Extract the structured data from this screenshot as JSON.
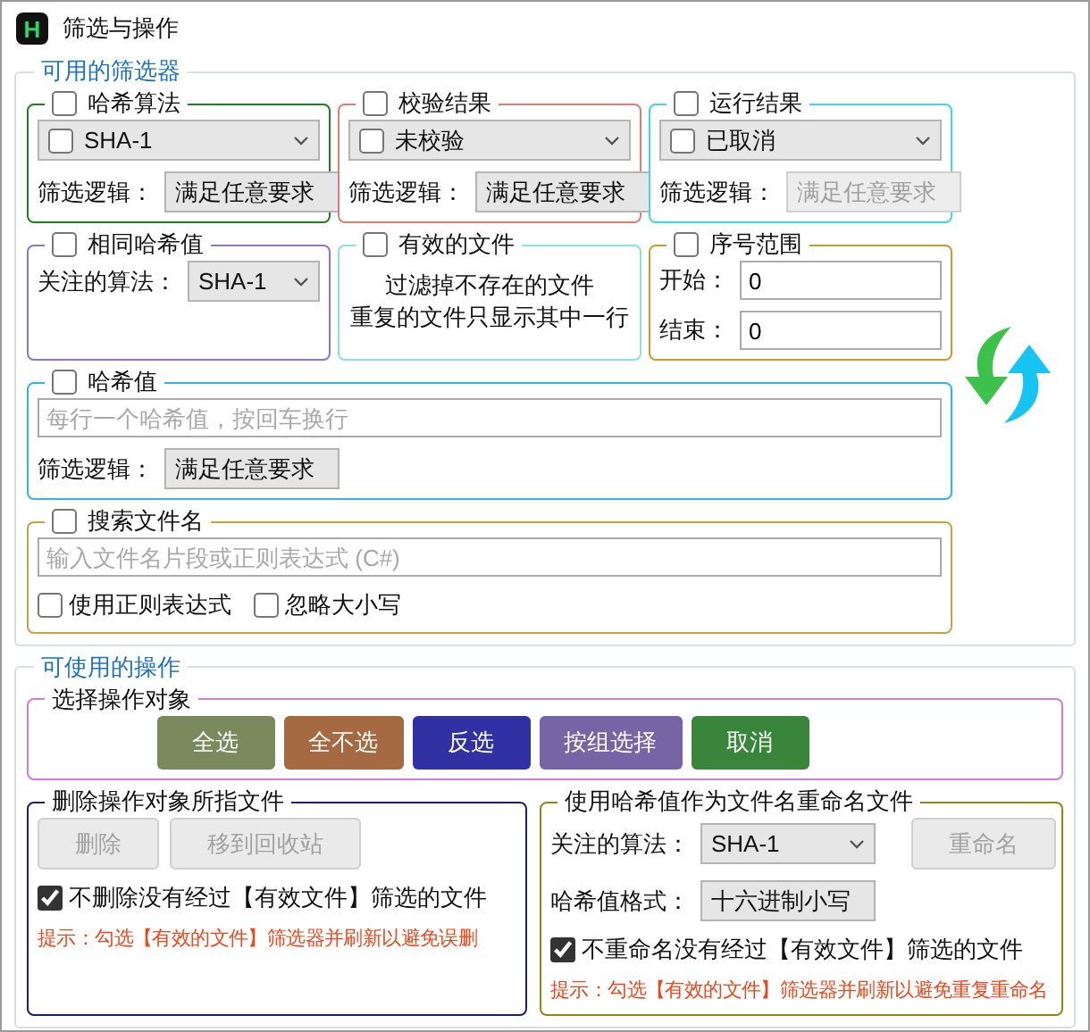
{
  "window": {
    "title": "筛选与操作",
    "app_icon_letter": "H"
  },
  "filters": {
    "title": "可用的筛选器",
    "groups": [
      {
        "label": "哈希算法",
        "checked": false,
        "color": "#1f7f22",
        "rows": [
          {
            "kind": "check_select",
            "value": "SHA-1",
            "checked": false
          },
          {
            "kind": "select",
            "label": "筛选逻辑：",
            "value": "满足任意要求",
            "disabled": false
          }
        ]
      },
      {
        "label": "校验结果",
        "checked": false,
        "color": "#e07b7b",
        "rows": [
          {
            "kind": "check_select",
            "value": "未校验",
            "checked": false
          },
          {
            "kind": "select",
            "label": "筛选逻辑：",
            "value": "满足任意要求",
            "disabled": false
          }
        ]
      },
      {
        "label": "运行结果",
        "checked": false,
        "color": "#3fd6de",
        "rows": [
          {
            "kind": "check_select",
            "value": "已取消",
            "checked": false
          },
          {
            "kind": "select",
            "label": "筛选逻辑：",
            "value": "满足任意要求",
            "disabled": true
          }
        ]
      },
      {
        "label": "相同哈希值",
        "checked": false,
        "color": "#8a78c4",
        "rows": [
          {
            "kind": "select",
            "label": "关注的算法：",
            "value": "SHA-1",
            "disabled": false
          }
        ]
      },
      {
        "label": "有效的文件",
        "checked": false,
        "color": "#86e4dc",
        "rows": [
          {
            "kind": "note",
            "lines": [
              "过滤掉不存在的文件",
              "重复的文件只显示其中一行"
            ]
          }
        ]
      },
      {
        "label": "序号范围",
        "checked": false,
        "color": "#c89b2e",
        "rows": [
          {
            "kind": "number",
            "label": "开始：",
            "value": "0"
          },
          {
            "kind": "number",
            "label": "结束：",
            "value": "0"
          }
        ]
      },
      {
        "label": "哈希值",
        "checked": false,
        "color": "#2cb8e6",
        "wide": true,
        "rows": [
          {
            "kind": "text",
            "placeholder": "每行一个哈希值，按回车换行"
          },
          {
            "kind": "select",
            "label": "筛选逻辑：",
            "value": "满足任意要求",
            "disabled": false
          }
        ]
      },
      {
        "label": "搜索文件名",
        "checked": false,
        "color": "#c4a444",
        "wide": true,
        "rows": [
          {
            "kind": "text",
            "placeholder": "输入文件名片段或正则表达式 (C#)"
          },
          {
            "kind": "checks",
            "items": [
              {
                "label": "使用正则表达式",
                "checked": false
              },
              {
                "label": "忽略大小写",
                "checked": false
              }
            ]
          }
        ]
      }
    ]
  },
  "actions": {
    "title": "可使用的操作",
    "select_group": {
      "title": "选择操作对象",
      "color": "#d77ad7",
      "buttons": [
        {
          "label": "全选",
          "color": "#7b8a5c"
        },
        {
          "label": "全不选",
          "color": "#a56a42"
        },
        {
          "label": "反选",
          "color": "#3131a4"
        },
        {
          "label": "按组选择",
          "color": "#7565a5"
        },
        {
          "label": "取消",
          "color": "#38853b"
        }
      ]
    },
    "groups": [
      {
        "label": "删除操作对象所指文件",
        "color": "#1e1e6e",
        "rows": [
          {
            "kind": "buttons",
            "items": [
              {
                "label": "删除",
                "disabled": true
              },
              {
                "label": "移到回收站",
                "disabled": true
              }
            ]
          },
          {
            "kind": "checks",
            "items": [
              {
                "label": "不删除没有经过【有效文件】筛选的文件",
                "checked": true
              }
            ]
          },
          {
            "kind": "hint",
            "text": "提示：勾选【有效的文件】筛选器并刷新以避免误删"
          }
        ]
      },
      {
        "label": "使用哈希值作为文件名重命名文件",
        "color": "#8a8a16",
        "rows": [
          {
            "kind": "select",
            "label": "关注的算法：",
            "value": "SHA-1",
            "disabled": false,
            "button": {
              "label": "重命名",
              "disabled": true
            }
          },
          {
            "kind": "select",
            "label": "哈希值格式：",
            "value": "十六进制小写",
            "disabled": false
          },
          {
            "kind": "checks",
            "items": [
              {
                "label": "不重命名没有经过【有效文件】筛选的文件",
                "checked": true
              }
            ]
          },
          {
            "kind": "hint",
            "text": "提示：勾选【有效的文件】筛选器并刷新以避免重复重命名"
          }
        ]
      }
    ]
  }
}
